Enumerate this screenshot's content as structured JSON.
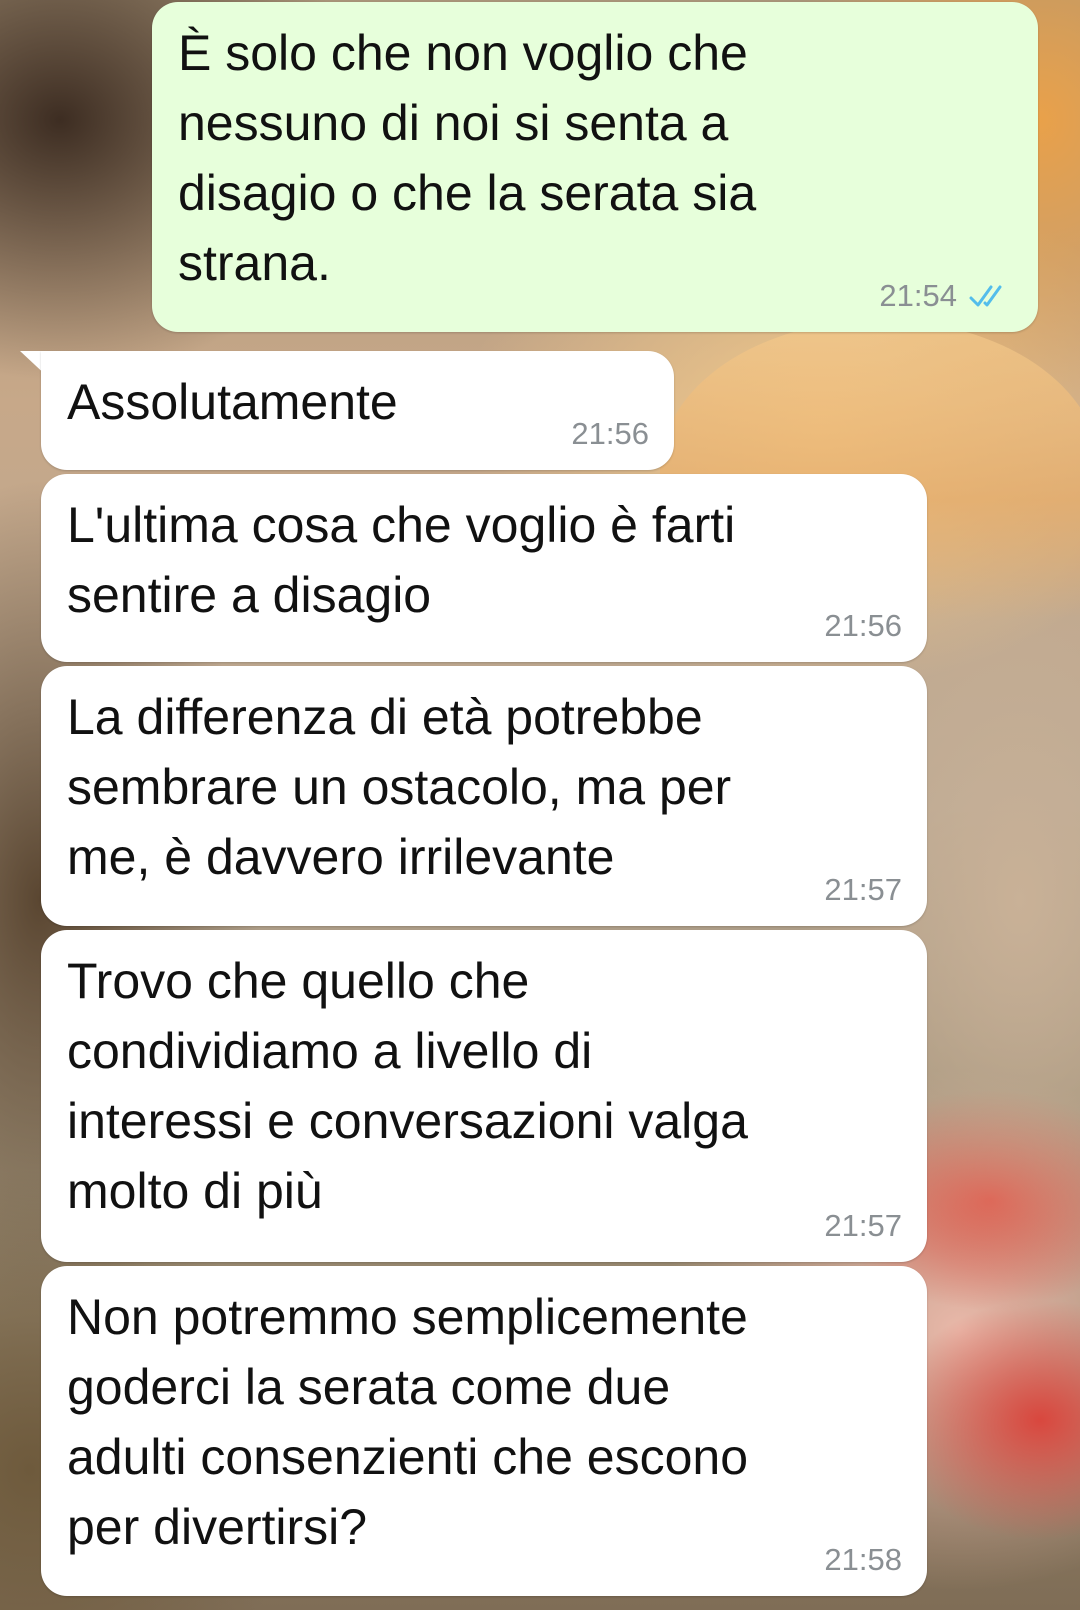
{
  "messages": [
    {
      "direction": "outgoing",
      "text": "È solo che non voglio che\nnessuno di noi si senta a\ndisagio o che la serata sia\nstrana.",
      "time": "21:54",
      "status_icon": "double-check-read-icon"
    },
    {
      "direction": "incoming",
      "text": "Assolutamente",
      "time": "21:56"
    },
    {
      "direction": "incoming",
      "text": "L'ultima cosa che voglio è farti\nsentire a disagio",
      "time": "21:56"
    },
    {
      "direction": "incoming",
      "text": "La differenza di età potrebbe\nsembrare un ostacolo, ma per\nme, è davvero irrilevante",
      "time": "21:57"
    },
    {
      "direction": "incoming",
      "text": "Trovo che quello che\ncondividiamo a livello di\ninteressi e conversazioni valga\nmolto di più",
      "time": "21:57"
    },
    {
      "direction": "incoming",
      "text": "Non potremmo semplicemente\ngoderci la serata come due\nadulti consenzienti che escono\nper divertirsi?",
      "time": "21:58"
    }
  ],
  "colors": {
    "outgoing_bubble": "#e7ffdb",
    "incoming_bubble": "#ffffff",
    "timestamp": "#8a8f93",
    "read_ticks": "#53bdeb"
  }
}
